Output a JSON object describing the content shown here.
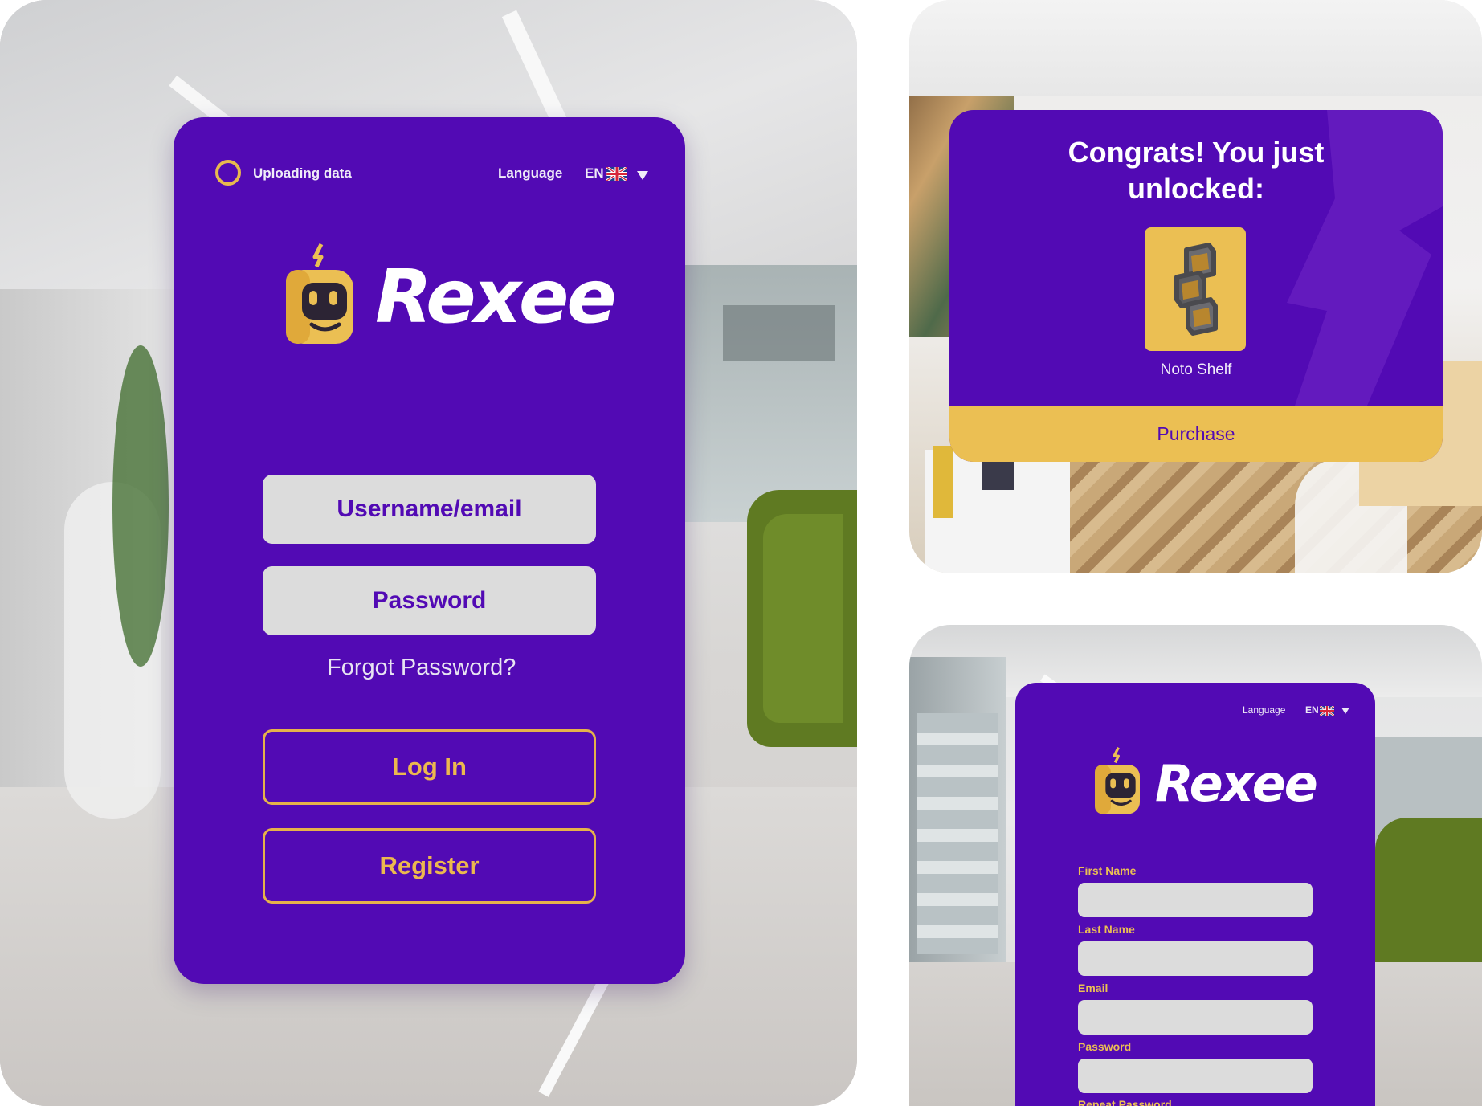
{
  "login": {
    "status_text": "Uploading data",
    "language_label": "Language",
    "language_code": "EN",
    "brand_name": "Rexee",
    "username_label": "Username/email",
    "password_label": "Password",
    "forgot_label": "Forgot Password?",
    "login_label": "Log In",
    "register_label": "Register"
  },
  "unlock": {
    "title_line1": "Congrats! You just",
    "title_line2": "unlocked:",
    "item_name": "Noto Shelf",
    "item_icon": "shelf-icon",
    "purchase_label": "Purchase"
  },
  "register": {
    "language_label": "Language",
    "language_code": "EN",
    "brand_name": "Rexee",
    "first_name_label": "First Name",
    "last_name_label": "Last Name",
    "email_label": "Email",
    "password_label": "Password",
    "repeat_password_label": "Repeat Password"
  },
  "colors": {
    "brand_purple": "#520ab4",
    "accent_yellow": "#ebbf53",
    "field_grey": "#dcdcdc"
  }
}
